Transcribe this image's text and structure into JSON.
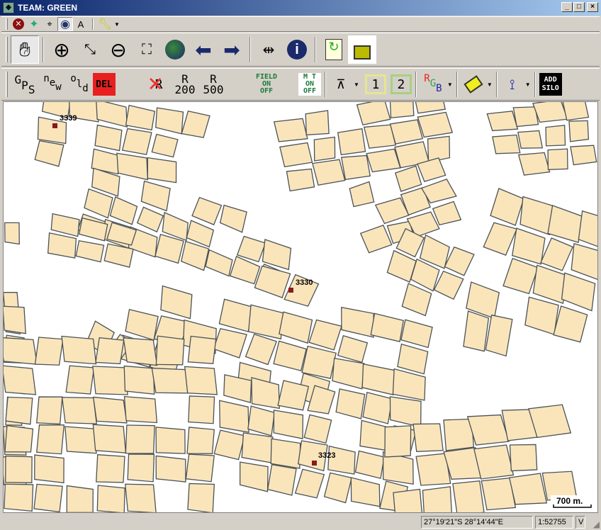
{
  "window": {
    "title": "TEAM: GREEN",
    "minimize": "_",
    "maximize": "□",
    "close": "×"
  },
  "toolbar1": {
    "items": [
      "close-red-icon",
      "satellite-map-icon",
      "satellite-target-icon",
      "globe-satellite-icon",
      "north-arrow-icon",
      "wrench-icon"
    ],
    "north_label": "A"
  },
  "toolbar2": {
    "items": [
      "pan-hand",
      "zoom-in",
      "zoom-extent-in",
      "zoom-out",
      "zoom-extent-out",
      "globe",
      "back",
      "forward",
      "measure",
      "info",
      "refresh-doc",
      "unlock"
    ]
  },
  "toolbar3": {
    "gps": {
      "g": "G",
      "p": "P",
      "s": "S"
    },
    "new": {
      "n": "n",
      "e": "e",
      "w": "w"
    },
    "old": {
      "o": "o",
      "l": "l",
      "d": "d"
    },
    "del": "DEL",
    "r_label": "R",
    "r200": {
      "r": "R",
      "n": "200"
    },
    "r500": {
      "r": "R",
      "n": "500"
    },
    "field": [
      "FIELD",
      "ON",
      "OFF"
    ],
    "mt": [
      "M T",
      "ON",
      "OFF"
    ],
    "one": "1",
    "two": "2",
    "rgb": {
      "r": "R",
      "g": "G",
      "b": "B"
    },
    "addsilo": [
      "ADD",
      "SILO"
    ]
  },
  "map": {
    "labels": [
      {
        "id": "3339"
      },
      {
        "id": "3330"
      },
      {
        "id": "3323"
      }
    ],
    "scale_bar": "700 m.",
    "colors": {
      "parcel": "#fae5bb",
      "outline": "#4a5258",
      "marker": "#8b1a1a"
    }
  },
  "status": {
    "coords": "27°19'21\"S 28°14'44\"E",
    "scale": "1:52755",
    "mode": "V"
  }
}
